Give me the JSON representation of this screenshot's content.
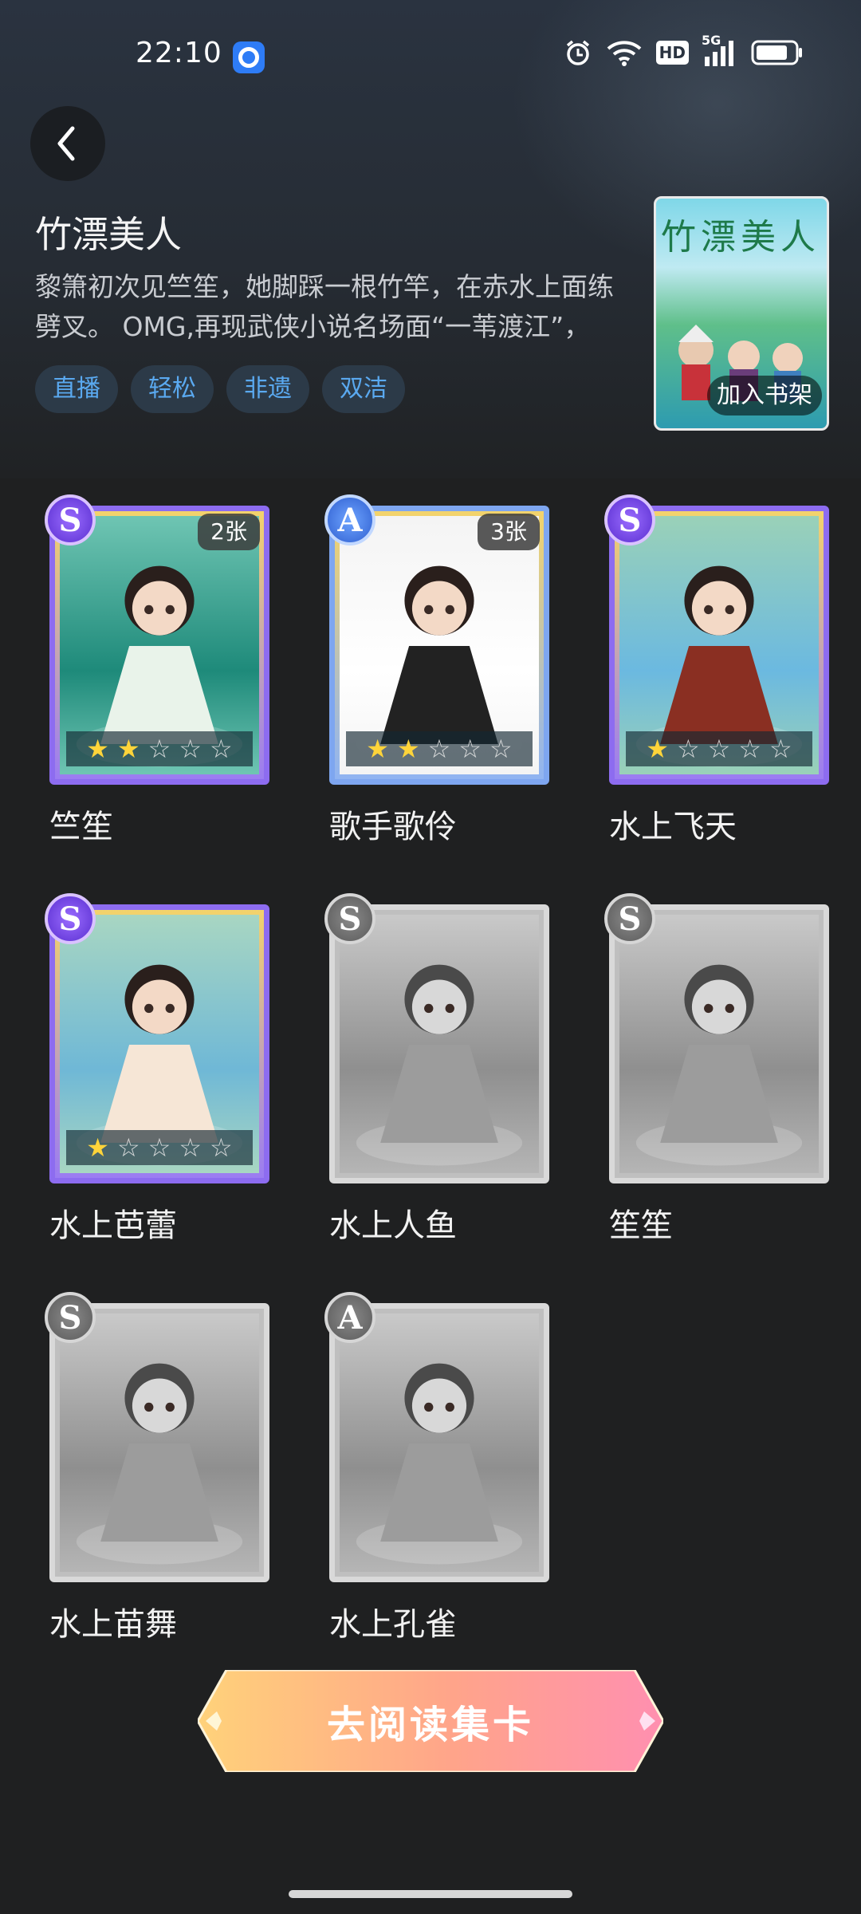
{
  "status_bar": {
    "time": "22:10",
    "network": "5G",
    "hd_label": "HD",
    "icons": [
      "app-notification-icon",
      "alarm-icon",
      "wifi-icon",
      "hd-icon",
      "signal-icon",
      "battery-icon"
    ]
  },
  "header": {
    "back_icon": "chevron-left-icon",
    "title": "竹漂美人",
    "description": "黎箫初次见竺笙，她脚踩一根竹竿，在赤水上面练劈叉。 OMG,再现武侠小说名场面“一苇渡江”，中...",
    "tags": [
      "直播",
      "轻松",
      "非遗",
      "双洁"
    ],
    "cover_title": "竹漂美人",
    "add_to_shelf": "加入书架"
  },
  "cards": [
    {
      "name": "竺笙",
      "rank": "S",
      "count": "2张",
      "stars": 2,
      "collected": true
    },
    {
      "name": "歌手歌伶",
      "rank": "A",
      "count": "3张",
      "stars": 2,
      "collected": true
    },
    {
      "name": "水上飞天",
      "rank": "S",
      "count": "",
      "stars": 1,
      "collected": true
    },
    {
      "name": "水上芭蕾",
      "rank": "S",
      "count": "",
      "stars": 1,
      "collected": true
    },
    {
      "name": "水上人鱼",
      "rank": "S",
      "count": "",
      "stars": 0,
      "collected": false
    },
    {
      "name": "笙笙",
      "rank": "S",
      "count": "",
      "stars": 0,
      "collected": false
    },
    {
      "name": "水上苗舞",
      "rank": "S",
      "count": "",
      "stars": 0,
      "collected": false
    },
    {
      "name": "水上孔雀",
      "rank": "A",
      "count": "",
      "stars": 0,
      "collected": false
    }
  ],
  "max_stars": 5,
  "footer": {
    "read_button": "去阅读集卡"
  },
  "colors": {
    "background": "#1f2021",
    "tag_text": "#5aa9f0",
    "star_on": "#ffd43a",
    "button_gradient": [
      "#ffd27a",
      "#ff8fb0"
    ]
  }
}
